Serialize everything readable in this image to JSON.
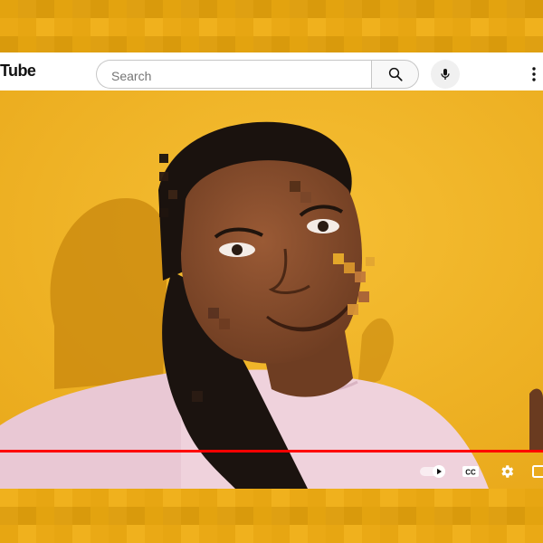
{
  "header": {
    "logo_text": "Tube",
    "search_placeholder": "Search"
  },
  "icons": {
    "search": "search-icon",
    "mic": "mic-icon",
    "more": "more-vert-icon",
    "autoplay": "autoplay-toggle-icon",
    "cc": "cc-icon",
    "settings": "gear-icon",
    "miniplayer": "miniplayer-icon"
  },
  "player": {
    "progress_fraction": 1.0,
    "autoplay_on": true,
    "cc_label": "CC"
  },
  "colors": {
    "background": "#e8a712",
    "video_bg": "#f2b526",
    "progress": "#ff0000",
    "header_bg": "#ffffff"
  }
}
